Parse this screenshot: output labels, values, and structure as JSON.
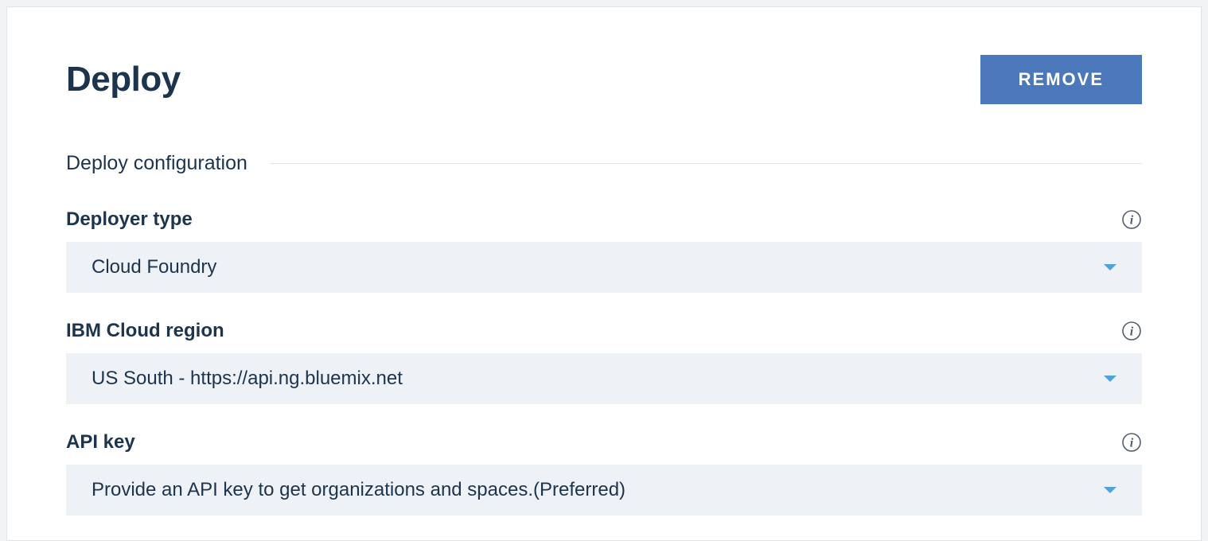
{
  "header": {
    "title": "Deploy",
    "remove_label": "REMOVE"
  },
  "section": {
    "title": "Deploy configuration"
  },
  "fields": {
    "deployer_type": {
      "label": "Deployer type",
      "value": "Cloud Foundry"
    },
    "region": {
      "label": "IBM Cloud region",
      "value": "US South - https://api.ng.bluemix.net"
    },
    "api_key": {
      "label": "API key",
      "value": "Provide an API key to get organizations and spaces.(Preferred)"
    }
  }
}
